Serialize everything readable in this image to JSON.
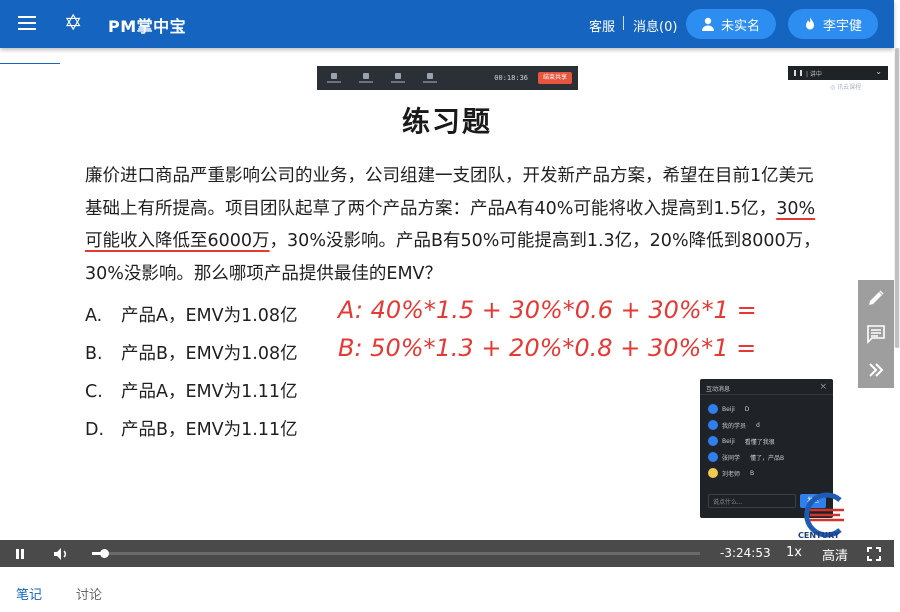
{
  "header": {
    "app_title": "PM掌中宝",
    "menu_icon": "hamburger-menu-icon",
    "logo_icon": "star-of-david-icon",
    "service_label": "客服",
    "messages_label": "消息(0)",
    "verify_label": "未实名",
    "user_name": "李宇健",
    "brand_color": "#1565c0",
    "pill_color": "#2c8ef0"
  },
  "meeting_toolbar": {
    "timer": "00:18:36",
    "end_label": "结束共享"
  },
  "slide": {
    "title": "练习题",
    "question_part1": "廉价进口商品严重影响公司的业务，公司组建一支团队，开发新产品方案，希望在目前1亿美元基础上有所提高。项目团队起草了两个产品方案：产品A有40%可能将收入提高到1.5亿，",
    "question_underlined": "30%可能收入降低至6000万",
    "question_part2": "，30%没影响。产品B有50%可能提高到1.3亿，20%降低到8000万，30%没影响。那么哪项产品提供最佳的EMV？",
    "options": [
      {
        "letter": "A.",
        "text": "产品A，EMV为1.08亿"
      },
      {
        "letter": "B.",
        "text": "产品B，EMV为1.08亿"
      },
      {
        "letter": "C.",
        "text": "产品A，EMV为1.11亿"
      },
      {
        "letter": "D.",
        "text": "产品B，EMV为1.11亿"
      }
    ],
    "handwriting_color": "#e53935",
    "annotation_color": "#e53935"
  },
  "chat_panel": {
    "title": "互动消息",
    "messages": [
      {
        "user": "Beiji",
        "text": "D"
      },
      {
        "user": "我的学员",
        "text": "d"
      },
      {
        "user": "Beiji",
        "text": "看懂了我很"
      },
      {
        "user": "张同学",
        "text": "懂了，产品B"
      },
      {
        "user": "刘老师",
        "text": "B"
      }
    ],
    "input_placeholder": "说点什么...",
    "send_label": "发送"
  },
  "watermark_text": "CENTURY",
  "side_tools": [
    "pencil-icon",
    "comment-icon",
    "double-chevron-right-icon"
  ],
  "player": {
    "time_remaining": "-3:24:53",
    "rate": "1x",
    "quality": "高清",
    "progress": 0.02
  },
  "tabs": [
    {
      "label": "笔记",
      "active": true
    },
    {
      "label": "讨论",
      "active": false
    }
  ]
}
